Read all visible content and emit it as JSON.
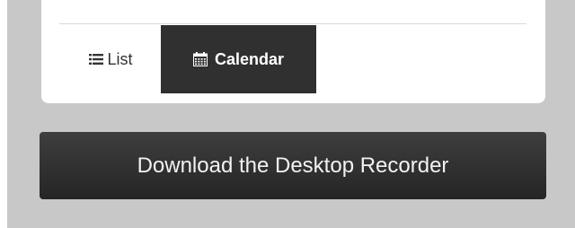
{
  "view_tabs": {
    "list": {
      "label": "List",
      "icon": "list-icon"
    },
    "calendar": {
      "label": "Calendar",
      "icon": "calendar-icon",
      "active": true
    }
  },
  "download_button": {
    "label": "Download the Desktop Recorder"
  },
  "colors": {
    "page_background": "#c8c8c8",
    "card_background": "#ffffff",
    "active_tab": "#303030",
    "button": "#2e2e2e"
  }
}
